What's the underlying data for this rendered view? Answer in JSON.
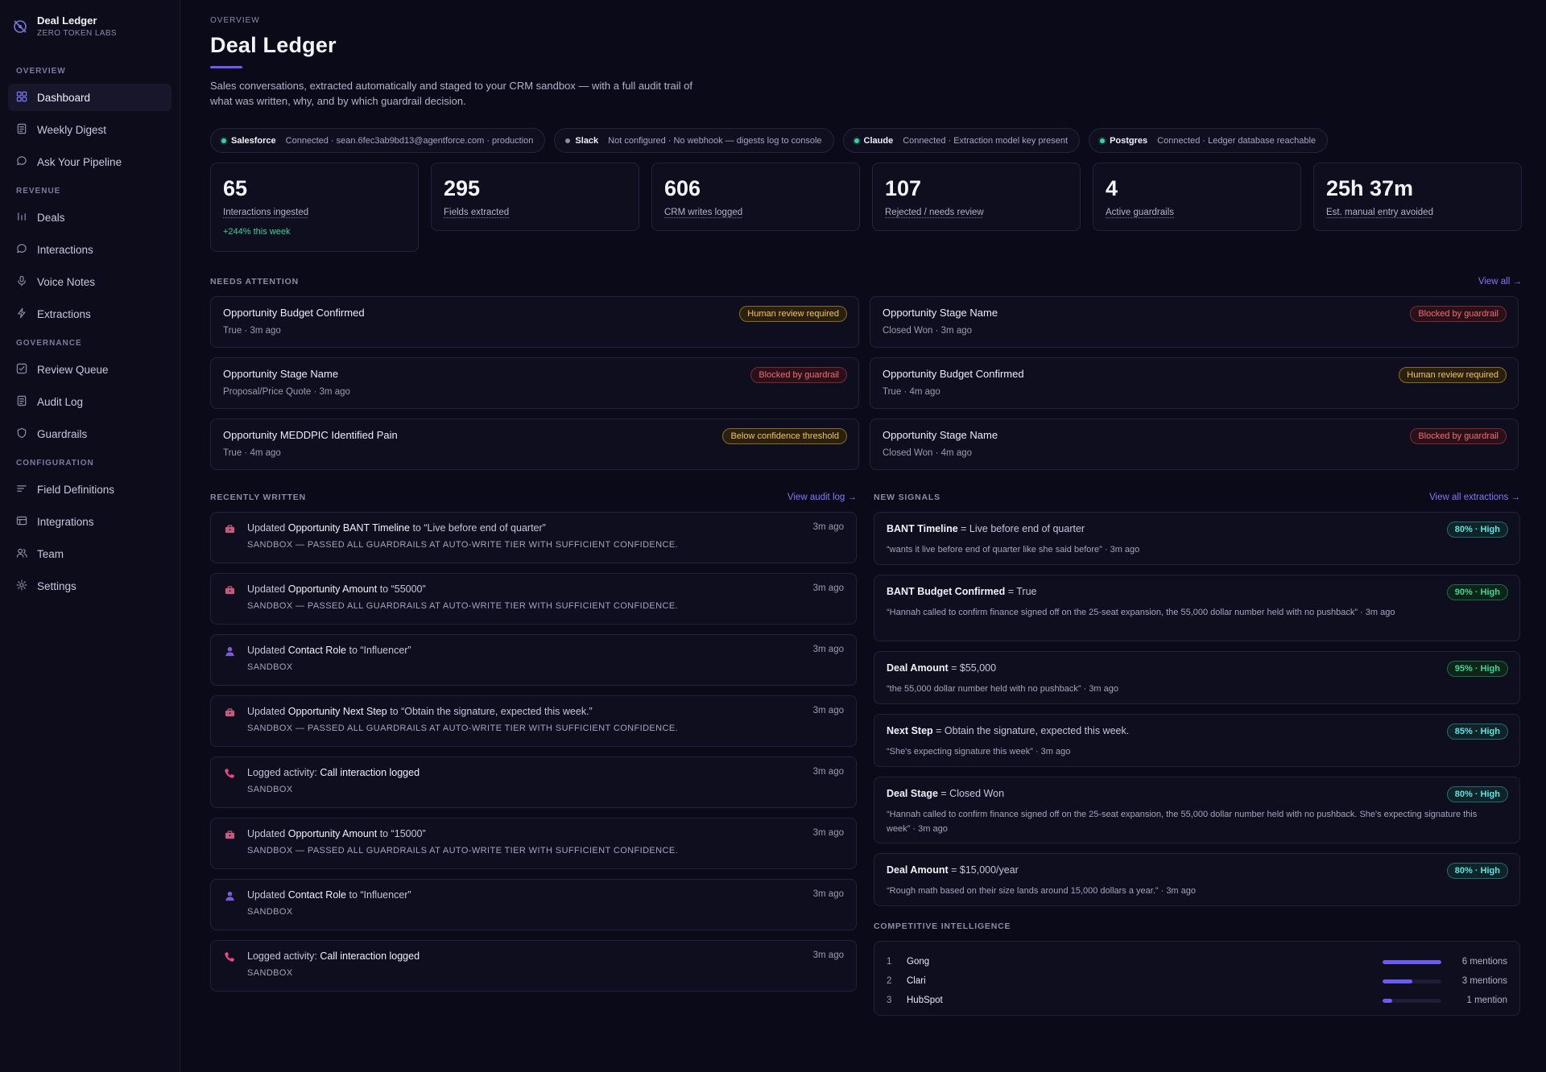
{
  "brand": {
    "name": "Deal Ledger",
    "org": "ZERO TOKEN LABS"
  },
  "sidebar": {
    "sections": [
      {
        "heading": "OVERVIEW",
        "items": [
          {
            "label": "Dashboard",
            "icon": "grid-icon",
            "active": true
          },
          {
            "label": "Weekly Digest",
            "icon": "document-icon"
          },
          {
            "label": "Ask Your Pipeline",
            "icon": "chat-icon"
          }
        ]
      },
      {
        "heading": "REVENUE",
        "items": [
          {
            "label": "Deals",
            "icon": "bars-icon"
          },
          {
            "label": "Interactions",
            "icon": "chat-icon"
          },
          {
            "label": "Voice Notes",
            "icon": "microphone-icon"
          },
          {
            "label": "Extractions",
            "icon": "bolt-icon"
          }
        ]
      },
      {
        "heading": "GOVERNANCE",
        "items": [
          {
            "label": "Review Queue",
            "icon": "checkbox-icon"
          },
          {
            "label": "Audit Log",
            "icon": "document-icon"
          },
          {
            "label": "Guardrails",
            "icon": "shield-icon"
          }
        ]
      },
      {
        "heading": "CONFIGURATION",
        "items": [
          {
            "label": "Field Definitions",
            "icon": "lines-icon"
          },
          {
            "label": "Integrations",
            "icon": "window-icon"
          },
          {
            "label": "Team",
            "icon": "users-icon"
          },
          {
            "label": "Settings",
            "icon": "gear-icon"
          }
        ]
      }
    ]
  },
  "header": {
    "eyebrow": "OVERVIEW",
    "title": "Deal Ledger",
    "description": "Sales conversations, extracted automatically and staged to your CRM sandbox — with a full audit trail of what was written, why, and by which guardrail decision."
  },
  "integrations": [
    {
      "name": "Salesforce",
      "detail": "Connected · sean.6fec3ab9bd13@agentforce.com · production",
      "status_color": "#35d399"
    },
    {
      "name": "Slack",
      "detail": "Not configured · No webhook — digests log to console",
      "status_color": "#8d8aa6"
    },
    {
      "name": "Claude",
      "detail": "Connected · Extraction model key present",
      "status_color": "#35d399"
    },
    {
      "name": "Postgres",
      "detail": "Connected · Ledger database reachable",
      "status_color": "#35d399"
    }
  ],
  "kpis": [
    {
      "value": "65",
      "label": "Interactions ingested",
      "delta": "+244% this week"
    },
    {
      "value": "295",
      "label": "Fields extracted"
    },
    {
      "value": "606",
      "label": "CRM writes logged"
    },
    {
      "value": "107",
      "label": "Rejected / needs review"
    },
    {
      "value": "4",
      "label": "Active guardrails"
    },
    {
      "value": "25h 37m",
      "label": "Est. manual entry avoided"
    }
  ],
  "needs_attention": {
    "title": "NEEDS ATTENTION",
    "link": "View all →",
    "items": [
      {
        "title": "Opportunity Budget Confirmed",
        "meta": "True · 3m ago",
        "badge": "Human review required",
        "kind": "review"
      },
      {
        "title": "Opportunity Stage Name",
        "meta": "Closed Won · 3m ago",
        "badge": "Blocked by guardrail",
        "kind": "blocked"
      },
      {
        "title": "Opportunity Stage Name",
        "meta": "Proposal/Price Quote · 3m ago",
        "badge": "Blocked by guardrail",
        "kind": "blocked"
      },
      {
        "title": "Opportunity Budget Confirmed",
        "meta": "True · 4m ago",
        "badge": "Human review required",
        "kind": "review"
      },
      {
        "title": "Opportunity MEDDPIC Identified Pain",
        "meta": "True · 4m ago",
        "badge": "Below confidence threshold",
        "kind": "confidence"
      },
      {
        "title": "Opportunity Stage Name",
        "meta": "Closed Won · 4m ago",
        "badge": "Blocked by guardrail",
        "kind": "blocked"
      }
    ]
  },
  "recently_written": {
    "title": "RECENTLY WRITTEN",
    "link": "View audit log →",
    "items": [
      {
        "icon": "briefcase-icon",
        "prefix": "Updated ",
        "field": "Opportunity BANT Timeline",
        "suffix": " to “Live before end of quarter”",
        "sub": "SANDBOX — PASSED ALL GUARDRAILS AT AUTO-WRITE TIER WITH SUFFICIENT CONFIDENCE.",
        "time": "3m ago"
      },
      {
        "icon": "briefcase-icon",
        "prefix": "Updated ",
        "field": "Opportunity Amount",
        "suffix": " to “55000”",
        "sub": "SANDBOX — PASSED ALL GUARDRAILS AT AUTO-WRITE TIER WITH SUFFICIENT CONFIDENCE.",
        "time": "3m ago"
      },
      {
        "icon": "person-icon",
        "prefix": "Updated ",
        "field": "Contact Role",
        "suffix": " to “Influencer”",
        "sub": "SANDBOX",
        "time": "3m ago"
      },
      {
        "icon": "briefcase-icon",
        "prefix": "Updated ",
        "field": "Opportunity Next Step",
        "suffix": " to “Obtain the signature, expected this week.”",
        "sub": "SANDBOX — PASSED ALL GUARDRAILS AT AUTO-WRITE TIER WITH SUFFICIENT CONFIDENCE.",
        "time": "3m ago"
      },
      {
        "icon": "phone-icon",
        "prefix": "Logged activity: ",
        "field": "Call interaction logged",
        "suffix": "",
        "sub": "SANDBOX",
        "time": "3m ago"
      },
      {
        "icon": "briefcase-icon",
        "prefix": "Updated ",
        "field": "Opportunity Amount",
        "suffix": " to “15000”",
        "sub": "SANDBOX — PASSED ALL GUARDRAILS AT AUTO-WRITE TIER WITH SUFFICIENT CONFIDENCE.",
        "time": "3m ago"
      },
      {
        "icon": "person-icon",
        "prefix": "Updated ",
        "field": "Contact Role",
        "suffix": " to “Influencer”",
        "sub": "SANDBOX",
        "time": "3m ago"
      },
      {
        "icon": "phone-icon",
        "prefix": "Logged activity: ",
        "field": "Call interaction logged",
        "suffix": "",
        "sub": "SANDBOX",
        "time": "3m ago"
      }
    ]
  },
  "new_signals": {
    "title": "NEW SIGNALS",
    "link": "View all extractions →",
    "items": [
      {
        "field": "BANT Timeline",
        "value": " = Live before end of quarter",
        "quote": "“wants it live before end of quarter like she said before” · 3m ago",
        "conf": "80% · High",
        "tone": "teal"
      },
      {
        "field": "BANT Budget Confirmed",
        "value": " = True",
        "quote": "“Hannah called to confirm finance signed off on the 25-seat expansion, the 55,000 dollar number held with no pushback” · 3m ago",
        "conf": "90% · High",
        "tone": "green"
      },
      {
        "field": "Deal Amount",
        "value": " = $55,000",
        "quote": "“the 55,000 dollar number held with no pushback” · 3m ago",
        "conf": "95% · High",
        "tone": "green"
      },
      {
        "field": "Next Step",
        "value": " = Obtain the signature, expected this week.",
        "quote": "“She's expecting signature this week” · 3m ago",
        "conf": "85% · High",
        "tone": "teal"
      },
      {
        "field": "Deal Stage",
        "value": " = Closed Won",
        "quote": "“Hannah called to confirm finance signed off on the 25-seat expansion, the 55,000 dollar number held with no pushback. She's expecting signature this week” · 3m ago",
        "conf": "80% · High",
        "tone": "teal"
      },
      {
        "field": "Deal Amount",
        "value": " = $15,000/year",
        "quote": "“Rough math based on their size lands around 15,000 dollars a year.” · 3m ago",
        "conf": "80% · High",
        "tone": "teal"
      }
    ]
  },
  "competitive": {
    "title": "COMPETITIVE INTELLIGENCE",
    "items": [
      {
        "rank": "1",
        "name": "Gong",
        "count": "6 mentions",
        "share": 1.0
      },
      {
        "rank": "2",
        "name": "Clari",
        "count": "3 mentions",
        "share": 0.5
      },
      {
        "rank": "3",
        "name": "HubSpot",
        "count": "1 mention",
        "share": 0.17
      }
    ]
  },
  "colors": {
    "accent": "#6b5cf6",
    "link": "#8178ff",
    "success": "#35d399",
    "warning": "#f6c453",
    "danger": "#f26b7a"
  }
}
